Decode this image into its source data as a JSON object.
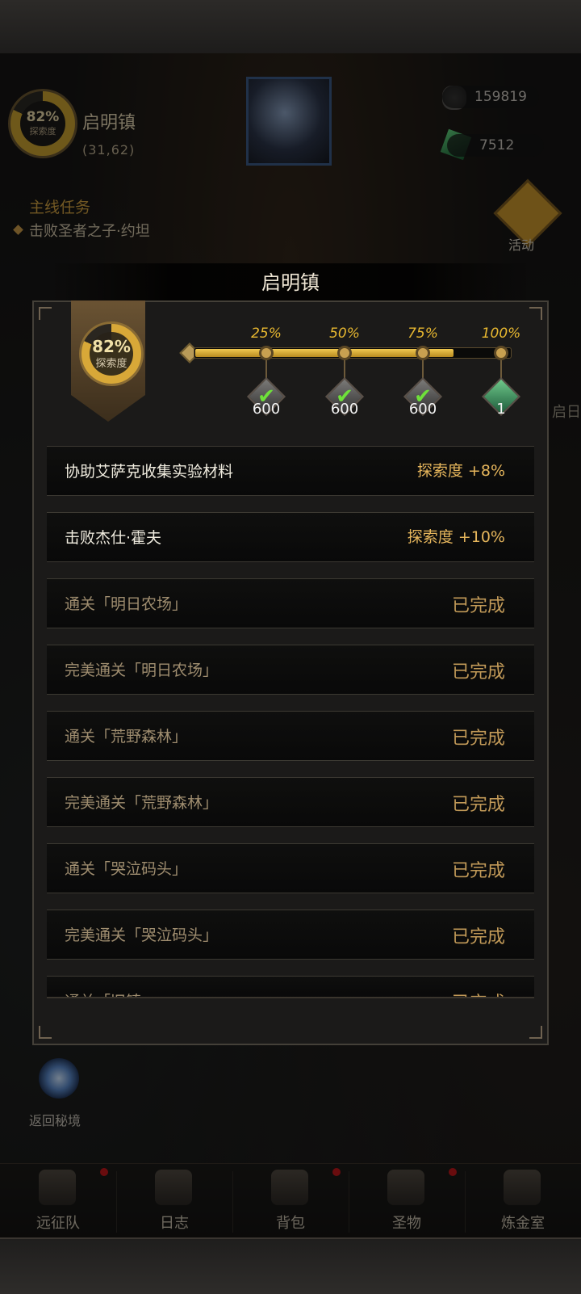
{
  "hud": {
    "explore_percent": "82%",
    "explore_label": "探索度",
    "town": "启明镇",
    "coords": "(31,62)",
    "stone_count": "159819",
    "gem_count": "7512",
    "quest_title": "主线任务",
    "quest_text": "击败圣者之子·约坦",
    "activity_label": "活动",
    "right_tag": "启日",
    "return_label": "返回秘境"
  },
  "panel": {
    "title": "启明镇",
    "explore_percent": "82%",
    "explore_label": "探索度",
    "progress_fraction": 0.82,
    "milestones": [
      {
        "pct": "25%",
        "reward": "600",
        "claimed": true,
        "kind": "stone"
      },
      {
        "pct": "50%",
        "reward": "600",
        "claimed": true,
        "kind": "stone"
      },
      {
        "pct": "75%",
        "reward": "600",
        "claimed": true,
        "kind": "stone"
      },
      {
        "pct": "100%",
        "reward": "1",
        "claimed": false,
        "kind": "emerald"
      }
    ],
    "tasks": [
      {
        "label": "协助艾萨克收集实验材料",
        "status": "探索度 +8%",
        "done": false
      },
      {
        "label": "击败杰仕·霍夫",
        "status": "探索度 +10%",
        "done": false
      },
      {
        "label": "通关「明日农场」",
        "status": "已完成",
        "done": true
      },
      {
        "label": "完美通关「明日农场」",
        "status": "已完成",
        "done": true
      },
      {
        "label": "通关「荒野森林」",
        "status": "已完成",
        "done": true
      },
      {
        "label": "完美通关「荒野森林」",
        "status": "已完成",
        "done": true
      },
      {
        "label": "通关「哭泣码头」",
        "status": "已完成",
        "done": true
      },
      {
        "label": "完美通关「哭泣码头」",
        "status": "已完成",
        "done": true
      },
      {
        "label": "通关「旧镇」",
        "status": "已完成",
        "done": true
      }
    ]
  },
  "nav": {
    "items": [
      {
        "label": "远征队",
        "badge": true
      },
      {
        "label": "日志",
        "badge": false
      },
      {
        "label": "背包",
        "badge": true
      },
      {
        "label": "圣物",
        "badge": true
      },
      {
        "label": "炼金室",
        "badge": false
      }
    ]
  },
  "colors": {
    "accent_gold": "#e8b830",
    "done_text": "#c29a58",
    "check_green": "#6ee03a"
  }
}
